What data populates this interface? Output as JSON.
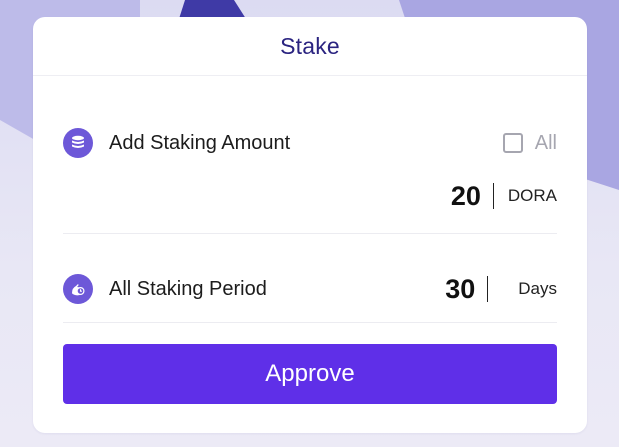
{
  "modal": {
    "title": "Stake"
  },
  "amount": {
    "label": "Add Staking Amount",
    "all_label": "All",
    "all_checked": false,
    "value": "20",
    "unit": "DORA",
    "icon": "coins-stack-icon"
  },
  "period": {
    "label": "All Staking Period",
    "value": "30",
    "unit": "Days",
    "icon": "clock-hand-icon"
  },
  "actions": {
    "approve_label": "Approve"
  },
  "colors": {
    "accent": "#5f2fe8",
    "title": "#2a2380",
    "icon_badge": "#6d58d8",
    "muted": "#a6a6b0"
  }
}
